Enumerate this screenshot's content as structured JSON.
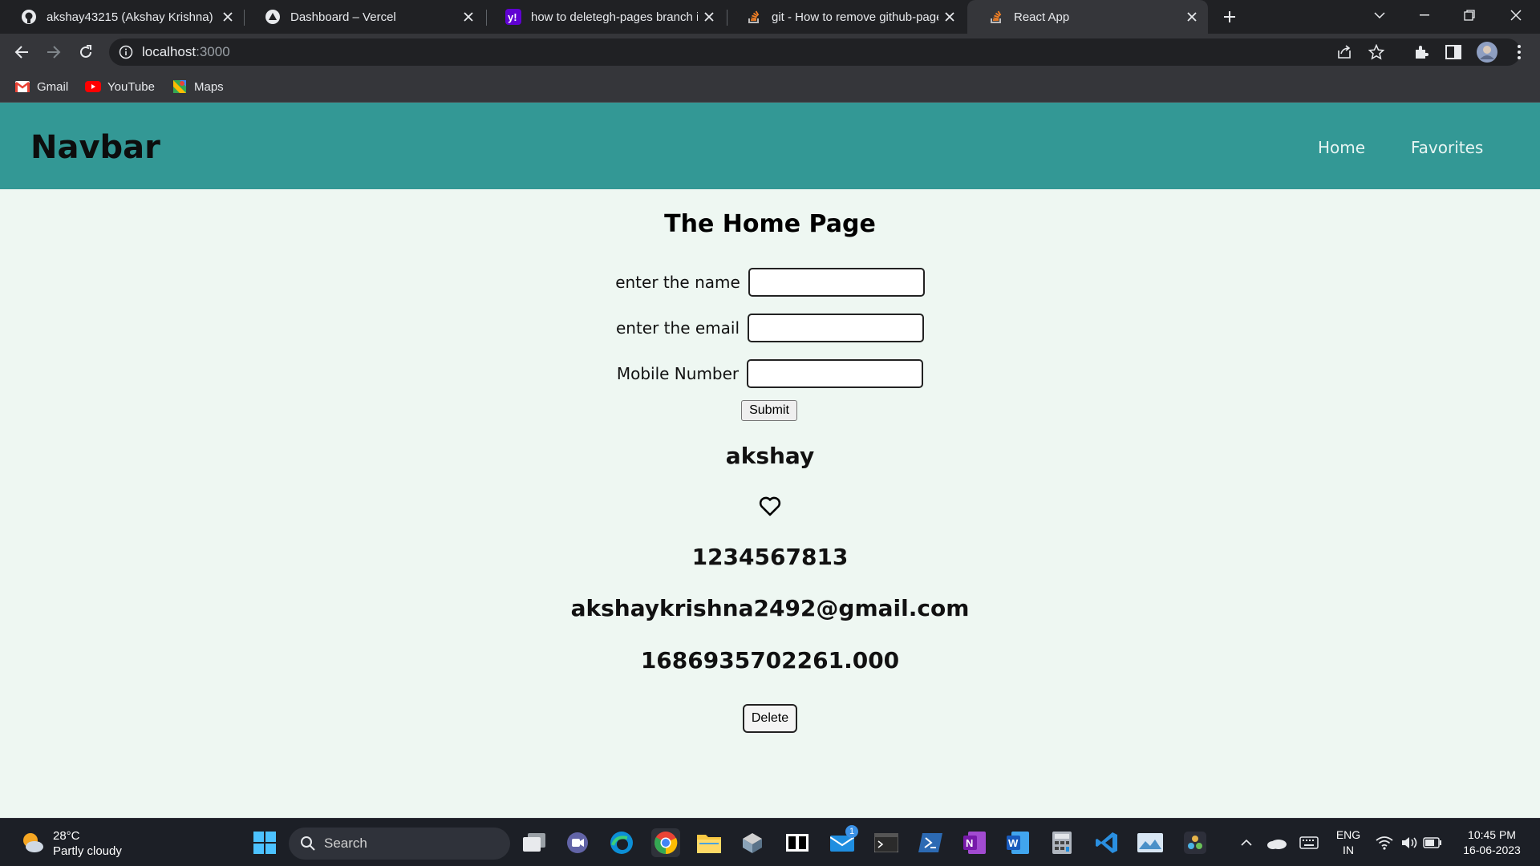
{
  "browser": {
    "tabs": [
      {
        "title": "akshay43215 (Akshay Krishna)",
        "icon": "github-icon"
      },
      {
        "title": "Dashboard – Vercel",
        "icon": "vercel-icon"
      },
      {
        "title": "how to deletegh-pages branch in",
        "icon": "yahoo-icon"
      },
      {
        "title": "git - How to remove github-pages",
        "icon": "stackoverflow-icon"
      },
      {
        "title": "React App",
        "icon": "stackoverflow-icon",
        "active": true
      }
    ],
    "url_host": "localhost",
    "url_port": ":3000",
    "bookmarks": [
      {
        "label": "Gmail",
        "icon": "gmail-icon"
      },
      {
        "label": "YouTube",
        "icon": "youtube-icon"
      },
      {
        "label": "Maps",
        "icon": "maps-icon"
      }
    ]
  },
  "app": {
    "navbar": {
      "brand": "Navbar",
      "links": [
        "Home",
        "Favorites"
      ]
    },
    "heading": "The Home Page",
    "form": {
      "name_label": "enter the name",
      "name_value": "",
      "email_label": "enter the email",
      "email_value": "",
      "mobile_label": "Mobile Number",
      "mobile_value": "",
      "submit_label": "Submit"
    },
    "record": {
      "name": "akshay",
      "favorite_icon": "heart-outline-icon",
      "mobile": "1234567813",
      "email": "akshaykrishna2492@gmail.com",
      "timestamp": "1686935702261.000",
      "delete_label": "Delete"
    }
  },
  "taskbar": {
    "weather_temp": "28°C",
    "weather_desc": "Partly cloudy",
    "search_label": "Search",
    "lang_top": "ENG",
    "lang_bottom": "IN",
    "time": "10:45 PM",
    "date": "16-06-2023",
    "mail_badge": "1"
  },
  "colors": {
    "navbar_bg": "#339895",
    "page_bg": "#eef7f2",
    "browser_dark": "#202124",
    "toolbar": "#35363a"
  }
}
